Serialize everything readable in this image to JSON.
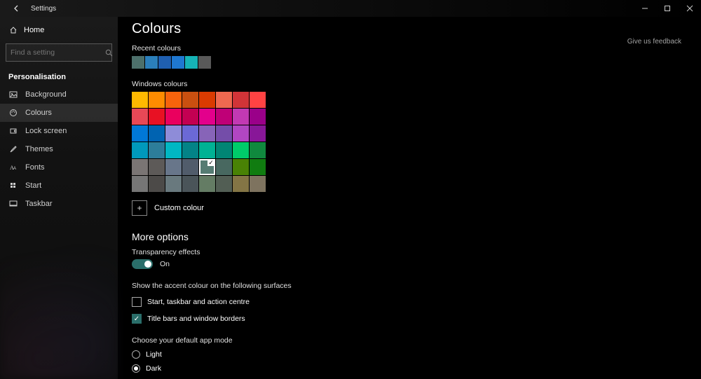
{
  "window": {
    "title": "Settings"
  },
  "sidebar": {
    "home": "Home",
    "search_placeholder": "Find a setting",
    "category": "Personalisation",
    "items": [
      {
        "icon": "image-icon",
        "label": "Background"
      },
      {
        "icon": "palette-icon",
        "label": "Colours"
      },
      {
        "icon": "lock-icon",
        "label": "Lock screen"
      },
      {
        "icon": "brush-icon",
        "label": "Themes"
      },
      {
        "icon": "font-icon",
        "label": "Fonts"
      },
      {
        "icon": "start-icon",
        "label": "Start"
      },
      {
        "icon": "taskbar-icon",
        "label": "Taskbar"
      }
    ],
    "active_index": 1
  },
  "main": {
    "feedback": "Give us feedback",
    "title": "Colours",
    "recent_label": "Recent colours",
    "recent_colours": [
      "#4d706b",
      "#2b7fbb",
      "#1f5fb0",
      "#1f78d1",
      "#16b3b6",
      "#595959"
    ],
    "windows_colours_label": "Windows colours",
    "windows_colours": [
      "#ffb900",
      "#ff8c00",
      "#f7630c",
      "#ca5010",
      "#da3b01",
      "#ef6950",
      "#d13438",
      "#ff4343",
      "#e74856",
      "#e81123",
      "#ea005e",
      "#c30052",
      "#e3008c",
      "#bf0077",
      "#c239b3",
      "#9a0089",
      "#0078d7",
      "#0063b1",
      "#8e8cd8",
      "#6b69d6",
      "#8764b8",
      "#744da9",
      "#b146c2",
      "#881798",
      "#0099bc",
      "#2d7d9a",
      "#00b7c3",
      "#038387",
      "#00b294",
      "#018574",
      "#00cc6a",
      "#10893e",
      "#7a7574",
      "#5d5a58",
      "#68768a",
      "#515c6b",
      "#567c73",
      "#486860",
      "#498205",
      "#107c10",
      "#767676",
      "#4c4a48",
      "#69797e",
      "#4a5459",
      "#647c64",
      "#525e54",
      "#847545",
      "#7e735f"
    ],
    "selected_colour_index": 36,
    "custom_colour_label": "Custom colour",
    "more_options": {
      "heading": "More options",
      "transparency_label": "Transparency effects",
      "transparency_state": "On",
      "surfaces_label": "Show the accent colour on the following surfaces",
      "surface_start": "Start, taskbar and action centre",
      "surface_start_checked": false,
      "surface_titlebars": "Title bars and window borders",
      "surface_titlebars_checked": true,
      "app_mode_label": "Choose your default app mode",
      "app_mode_light": "Light",
      "app_mode_dark": "Dark",
      "app_mode_selected": "dark"
    }
  }
}
